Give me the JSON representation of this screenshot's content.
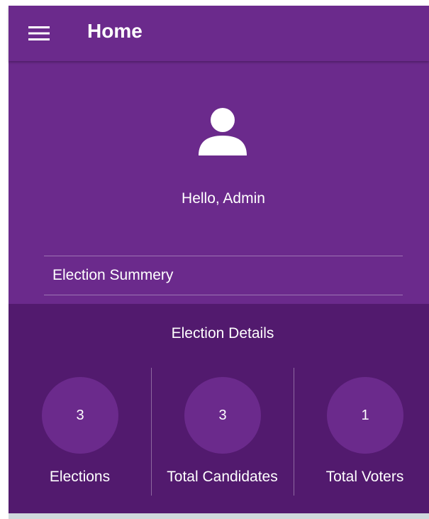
{
  "app_bar": {
    "title": "Home",
    "menu_icon": "hamburger-menu-icon"
  },
  "profile": {
    "avatar_icon": "person-icon",
    "greeting": "Hello, Admin"
  },
  "summary": {
    "label": "Election Summery"
  },
  "details": {
    "title": "Election Details",
    "stats": [
      {
        "value": "3",
        "label": "Elections"
      },
      {
        "value": "3",
        "label": "Total Candidates"
      },
      {
        "value": "1",
        "label": "Total Voters"
      }
    ]
  },
  "colors": {
    "primary": "#6b2a8c",
    "primary_dark": "#521a6e",
    "text": "#ffffff"
  }
}
